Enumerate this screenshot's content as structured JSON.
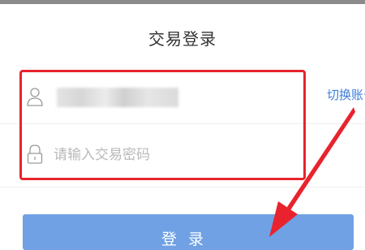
{
  "page": {
    "title": "交易登录"
  },
  "form": {
    "username_value": "",
    "password_placeholder": "请输入交易密码",
    "switch_label": "切换账号",
    "login_label": "登录"
  },
  "icons": {
    "username": "user-icon",
    "password": "lock-icon"
  },
  "colors": {
    "annotation_red": "#e8232d",
    "link_blue": "#3d7dd8",
    "button_blue": "#6fa1e4"
  }
}
